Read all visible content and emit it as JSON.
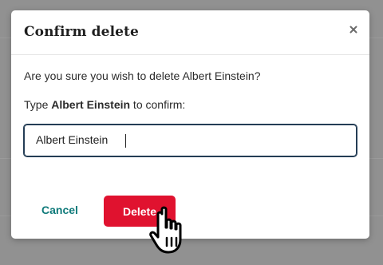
{
  "modal": {
    "title": "Confirm delete",
    "question": "Are you sure you wish to delete Albert Einstein?",
    "confirm_prefix": "Type ",
    "confirm_name": "Albert Einstein",
    "confirm_suffix": " to confirm:",
    "input_value": "Albert Einstein",
    "cancel_label": "Cancel",
    "delete_label": "Delete",
    "close_symbol": "×"
  },
  "colors": {
    "accent_delete": "#e0122f",
    "accent_cancel": "#0f7a7a",
    "field_border": "#243d55"
  },
  "icons": [
    "close-icon",
    "hand-pointer-cursor-icon"
  ]
}
